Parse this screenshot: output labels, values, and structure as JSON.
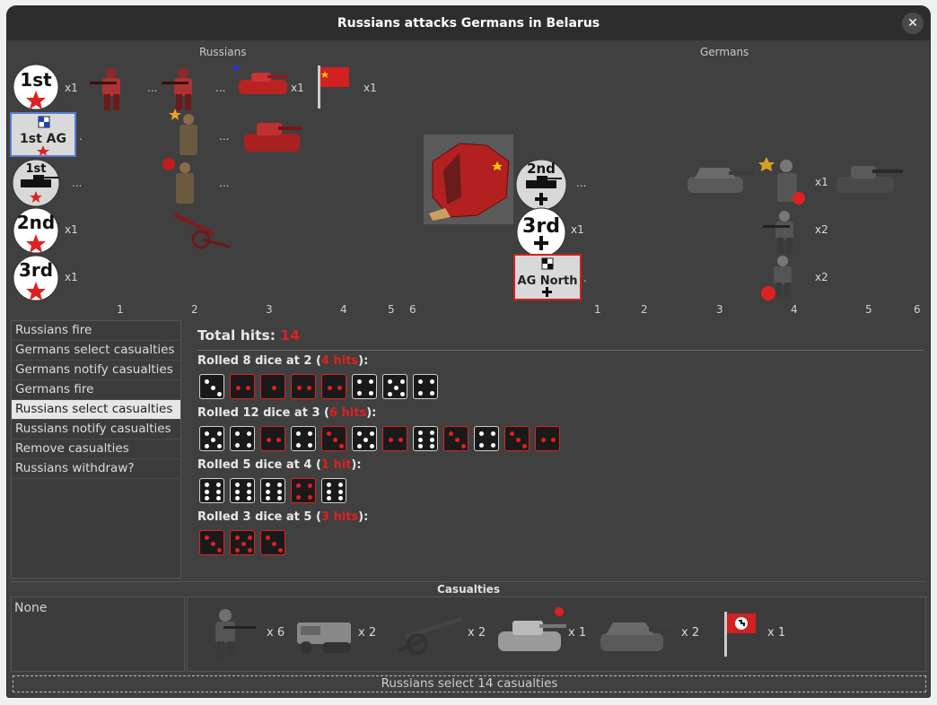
{
  "window": {
    "title": "Russians attacks Germans in Belarus",
    "close_icon": "close-icon"
  },
  "sides": {
    "left": "Russians",
    "right": "Germans"
  },
  "russians": {
    "hq_badges": [
      {
        "label": "1st",
        "mult": "x1"
      },
      {
        "label": "1st AG",
        "mult": "."
      },
      {
        "label": "1st",
        "mult": "..."
      },
      {
        "label": "2nd",
        "mult": "x1"
      },
      {
        "label": "3rd",
        "mult": "x1"
      }
    ],
    "extra_texts": {
      "dots1": "...",
      "dots2": "...",
      "dots3": "...",
      "tank_mult": "x1",
      "flag_mult": "x1"
    },
    "columns": [
      "1",
      "2",
      "3",
      "4",
      "5",
      "6"
    ]
  },
  "germans": {
    "hq_badges": [
      {
        "label": "2nd",
        "mult": "..."
      },
      {
        "label": "3rd",
        "mult": "x1"
      },
      {
        "label": "AG North",
        "mult": "."
      }
    ],
    "unit_mults": [
      "x1",
      "x2",
      "x2"
    ],
    "columns": [
      "1",
      "2",
      "3",
      "4",
      "5",
      "6"
    ]
  },
  "steps": [
    "Russians fire",
    "Germans select casualties",
    "Germans notify casualties",
    "Germans fire",
    "Russians select casualties",
    "Russians notify casualties",
    "Remove casualties",
    "Russians withdraw?"
  ],
  "active_step_index": 4,
  "dice": {
    "total_label": "Total hits:",
    "total_value": "14",
    "rolls": [
      {
        "prefix": "Rolled 8 dice at 2 (",
        "hits": "4 hits",
        "suffix": "):",
        "faces": [
          3,
          2,
          1,
          2,
          2,
          4,
          5,
          4
        ],
        "hit": [
          false,
          true,
          true,
          true,
          true,
          false,
          false,
          false
        ]
      },
      {
        "prefix": "Rolled 12 dice at 3 (",
        "hits": "6 hits",
        "suffix": "):",
        "faces": [
          5,
          4,
          2,
          4,
          3,
          5,
          2,
          6,
          3,
          4,
          3,
          2
        ],
        "hit": [
          false,
          false,
          true,
          false,
          true,
          false,
          true,
          false,
          true,
          false,
          true,
          true
        ]
      },
      {
        "prefix": "Rolled 5 dice at 4 (",
        "hits": "1 hit",
        "suffix": "):",
        "faces": [
          6,
          6,
          6,
          4,
          6
        ],
        "hit": [
          false,
          false,
          false,
          true,
          false
        ]
      },
      {
        "prefix": "Rolled 3 dice at 5 (",
        "hits": "3 hits",
        "suffix": "):",
        "faces": [
          3,
          5,
          3
        ],
        "hit": [
          true,
          true,
          true
        ]
      }
    ]
  },
  "casualties": {
    "header": "Casualties",
    "left_text": "None",
    "items": [
      {
        "icon": "german-infantry-icon",
        "mult": "x 6"
      },
      {
        "icon": "halftrack-icon",
        "mult": "x 2"
      },
      {
        "icon": "artillery-icon",
        "mult": "x 2"
      },
      {
        "icon": "heavy-tank-icon",
        "mult": "x 1"
      },
      {
        "icon": "assault-gun-icon",
        "mult": "x 2"
      },
      {
        "icon": "german-flag-icon",
        "mult": "x 1"
      }
    ]
  },
  "status": "Russians select 14 casualties",
  "colors": {
    "hit_red": "#e02020",
    "soviet_red": "#c62828",
    "german_grey": "#5a5a5a"
  }
}
